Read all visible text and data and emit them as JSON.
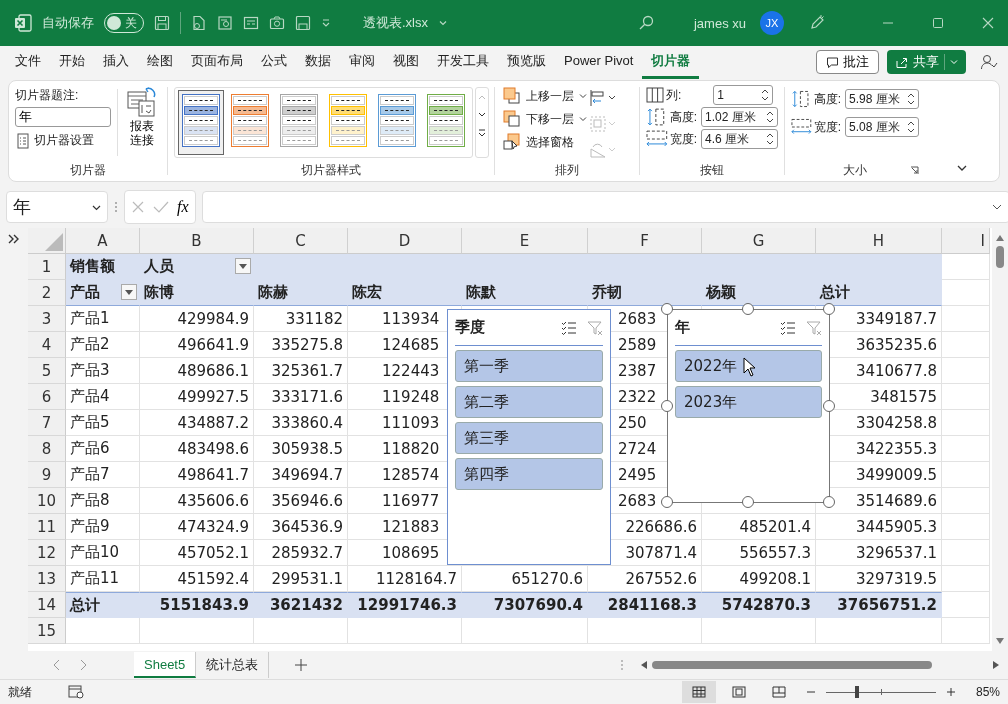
{
  "title_bar": {
    "autosave_label": "自动保存",
    "autosave": {
      "on": false,
      "label": "关"
    },
    "file_name": "透视表.xlsx",
    "user_name": "james xu",
    "avatar_initials": "JX"
  },
  "menu_tabs": [
    {
      "label": "文件",
      "selected": false
    },
    {
      "label": "开始",
      "selected": false
    },
    {
      "label": "插入",
      "selected": false
    },
    {
      "label": "绘图",
      "selected": false
    },
    {
      "label": "页面布局",
      "selected": false
    },
    {
      "label": "公式",
      "selected": false
    },
    {
      "label": "数据",
      "selected": false
    },
    {
      "label": "审阅",
      "selected": false
    },
    {
      "label": "视图",
      "selected": false
    },
    {
      "label": "开发工具",
      "selected": false
    },
    {
      "label": "预览版",
      "selected": false
    },
    {
      "label": "Power Pivot",
      "selected": false
    },
    {
      "label": "切片器",
      "selected": true
    }
  ],
  "comments_button": "批注",
  "share_button": "共享",
  "ribbon": {
    "slicer": {
      "caption_label": "切片器题注:",
      "caption_value": "年",
      "settings_button": "切片器设置",
      "connections_button": "报表连接",
      "group_label": "切片器"
    },
    "styles": {
      "swatches": [
        {
          "color": "#4472c4",
          "selected": true
        },
        {
          "color": "#ed7d31",
          "selected": false
        },
        {
          "color": "#a5a5a5",
          "selected": false
        },
        {
          "color": "#ffc000",
          "selected": false
        },
        {
          "color": "#5b9bd5",
          "selected": false
        },
        {
          "color": "#70ad47",
          "selected": false
        }
      ],
      "group_label": "切片器样式"
    },
    "arrange": {
      "bring_forward": "上移一层",
      "send_backward": "下移一层",
      "selection_pane": "选择窗格",
      "group_label": "排列"
    },
    "buttons": {
      "columns_label": "列:",
      "columns_value": "1",
      "height_label": "高度:",
      "height_value": "1.02 厘米",
      "width_label": "宽度:",
      "width_value": "4.6 厘米",
      "group_label": "按钮"
    },
    "size": {
      "height_label": "高度:",
      "height_value": "5.98 厘米",
      "width_label": "宽度:",
      "width_value": "5.08 厘米",
      "group_label": "大小"
    }
  },
  "formula_bar": {
    "name_box": "年",
    "fx": "fx"
  },
  "sheet": {
    "columns": [
      "A",
      "B",
      "C",
      "D",
      "E",
      "F",
      "G",
      "H",
      "I"
    ],
    "rows": [
      {
        "label": "1",
        "kind": "pivot-header",
        "cells": {
          "A": {
            "text": "销售额"
          },
          "B": {
            "text": "人员",
            "filter": true
          }
        }
      },
      {
        "label": "2",
        "kind": "pivot-header",
        "cells": {
          "A": {
            "text": "产品",
            "filter": true
          },
          "B": {
            "text": "陈博"
          },
          "C": {
            "text": "陈赫"
          },
          "D": {
            "text": "陈宏"
          },
          "E": {
            "text": "陈默"
          },
          "F": {
            "text": "乔韧"
          },
          "G": {
            "text": "杨颖"
          },
          "H": {
            "text": "总计"
          }
        }
      },
      {
        "label": "3",
        "kind": "data",
        "cells": {
          "A": {
            "text": "产品1"
          },
          "B": {
            "text": "429984.9"
          },
          "C": {
            "text": "331182"
          },
          "D": {
            "text": "113934",
            "cut": true
          },
          "F": {
            "text": "2683",
            "cut": true
          },
          "H": {
            "text": "3349187.7"
          }
        }
      },
      {
        "label": "4",
        "kind": "data",
        "cells": {
          "A": {
            "text": "产品2"
          },
          "B": {
            "text": "496641.9"
          },
          "C": {
            "text": "335275.8"
          },
          "D": {
            "text": "124685",
            "cut": true
          },
          "F": {
            "text": "2589",
            "cut": true
          },
          "H": {
            "text": "3635235.6"
          }
        }
      },
      {
        "label": "5",
        "kind": "data",
        "cells": {
          "A": {
            "text": "产品3"
          },
          "B": {
            "text": "489686.1"
          },
          "C": {
            "text": "325361.7"
          },
          "D": {
            "text": "122443",
            "cut": true
          },
          "F": {
            "text": "2387",
            "cut": true
          },
          "H": {
            "text": "3410677.8"
          }
        }
      },
      {
        "label": "6",
        "kind": "data",
        "cells": {
          "A": {
            "text": "产品4"
          },
          "B": {
            "text": "499927.5"
          },
          "C": {
            "text": "333171.6"
          },
          "D": {
            "text": "119248",
            "cut": true
          },
          "F": {
            "text": "2322",
            "cut": true
          },
          "H": {
            "text": "3481575"
          }
        }
      },
      {
        "label": "7",
        "kind": "data",
        "cells": {
          "A": {
            "text": "产品5"
          },
          "B": {
            "text": "434887.2"
          },
          "C": {
            "text": "333860.4"
          },
          "D": {
            "text": "111093",
            "cut": true
          },
          "F": {
            "text": "250",
            "cut": true
          },
          "H": {
            "text": "3304258.8"
          }
        }
      },
      {
        "label": "8",
        "kind": "data",
        "cells": {
          "A": {
            "text": "产品6"
          },
          "B": {
            "text": "483498.6"
          },
          "C": {
            "text": "305938.5"
          },
          "D": {
            "text": "118820",
            "cut": true
          },
          "F": {
            "text": "2724",
            "cut": true
          },
          "H": {
            "text": "3422355.3"
          }
        }
      },
      {
        "label": "9",
        "kind": "data",
        "cells": {
          "A": {
            "text": "产品7"
          },
          "B": {
            "text": "498641.7"
          },
          "C": {
            "text": "349694.7"
          },
          "D": {
            "text": "128574",
            "cut": true
          },
          "F": {
            "text": "2495",
            "cut": true
          },
          "H": {
            "text": "3499009.5"
          }
        }
      },
      {
        "label": "10",
        "kind": "data",
        "cells": {
          "A": {
            "text": "产品8"
          },
          "B": {
            "text": "435606.6"
          },
          "C": {
            "text": "356946.6"
          },
          "D": {
            "text": "116977",
            "cut": true
          },
          "F": {
            "text": "2683",
            "cut": true
          },
          "H": {
            "text": "3514689.6"
          }
        }
      },
      {
        "label": "11",
        "kind": "data",
        "cells": {
          "A": {
            "text": "产品9"
          },
          "B": {
            "text": "474324.9"
          },
          "C": {
            "text": "364536.9"
          },
          "D": {
            "text": "121883",
            "cut": true
          },
          "F": {
            "text": "226686.6"
          },
          "G": {
            "text": "485201.4"
          },
          "H": {
            "text": "3445905.3"
          }
        }
      },
      {
        "label": "12",
        "kind": "data",
        "cells": {
          "A": {
            "text": "产品10"
          },
          "B": {
            "text": "457052.1"
          },
          "C": {
            "text": "285932.7"
          },
          "D": {
            "text": "108695",
            "cut": true
          },
          "F": {
            "text": "307871.4"
          },
          "G": {
            "text": "556557.3"
          },
          "H": {
            "text": "3296537.1"
          }
        }
      },
      {
        "label": "13",
        "kind": "data",
        "cells": {
          "A": {
            "text": "产品11"
          },
          "B": {
            "text": "451592.4"
          },
          "C": {
            "text": "299531.1"
          },
          "D": {
            "text": "1128164.7"
          },
          "E": {
            "text": "651270.6"
          },
          "F": {
            "text": "267552.6"
          },
          "G": {
            "text": "499208.1"
          },
          "H": {
            "text": "3297319.5"
          }
        }
      },
      {
        "label": "14",
        "kind": "total",
        "cells": {
          "A": {
            "text": "总计"
          },
          "B": {
            "text": "5151843.9"
          },
          "C": {
            "text": "3621432"
          },
          "D": {
            "text": "12991746.3"
          },
          "E": {
            "text": "7307690.4"
          },
          "F": {
            "text": "2841168.3"
          },
          "G": {
            "text": "5742870.3"
          },
          "H": {
            "text": "37656751.2"
          }
        }
      },
      {
        "label": "15",
        "kind": "blank",
        "cells": {}
      }
    ]
  },
  "slicers": [
    {
      "title": "季度",
      "active": false,
      "items": [
        {
          "label": "第一季",
          "selected": true
        },
        {
          "label": "第二季",
          "selected": true
        },
        {
          "label": "第三季",
          "selected": true
        },
        {
          "label": "第四季",
          "selected": true
        }
      ]
    },
    {
      "title": "年",
      "active": true,
      "items": [
        {
          "label": "2022年",
          "selected": true
        },
        {
          "label": "2023年",
          "selected": true
        }
      ]
    }
  ],
  "sheet_tabs": [
    {
      "label": "Sheet5",
      "selected": true
    },
    {
      "label": "统计总表",
      "selected": false
    }
  ],
  "status_bar": {
    "status": "就绪",
    "zoom": {
      "level": 0.28
    },
    "zoom_label": "85%"
  }
}
